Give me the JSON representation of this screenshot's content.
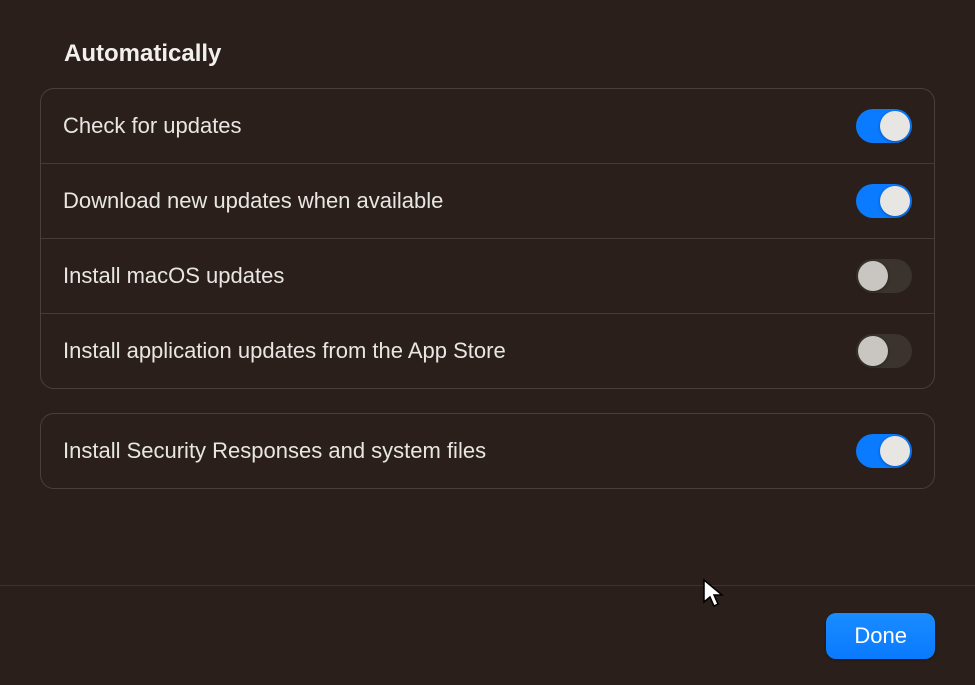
{
  "heading": "Automatically",
  "groups": [
    {
      "rows": [
        {
          "label": "Check for updates",
          "on": true
        },
        {
          "label": "Download new updates when available",
          "on": true
        },
        {
          "label": "Install macOS updates",
          "on": false
        },
        {
          "label": "Install application updates from the App Store",
          "on": false
        }
      ]
    },
    {
      "rows": [
        {
          "label": "Install Security Responses and system files",
          "on": true
        }
      ]
    }
  ],
  "footer": {
    "done_label": "Done"
  }
}
